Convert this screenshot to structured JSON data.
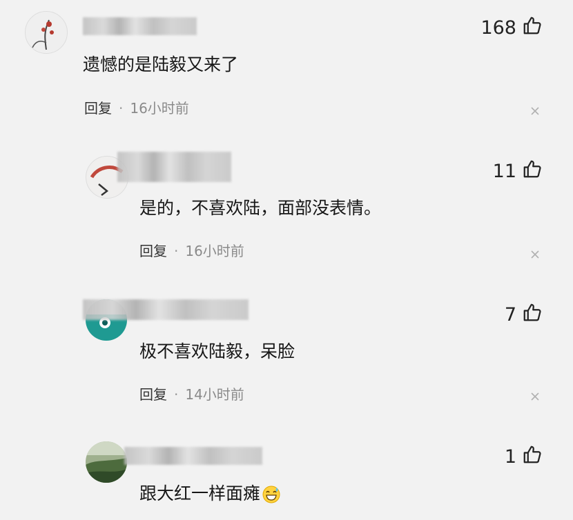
{
  "comments": [
    {
      "likes": "168",
      "text": "遗憾的是陆毅又来了",
      "reply_label": "回复",
      "time": "16小时前"
    },
    {
      "likes": "11",
      "text": "是的，不喜欢陆，面部没表情。",
      "reply_label": "回复",
      "time": "16小时前"
    },
    {
      "likes": "7",
      "text": "极不喜欢陆毅，呆脸",
      "reply_label": "回复",
      "time": "14小时前"
    },
    {
      "likes": "1",
      "text": "跟大红一样面瘫",
      "emoji": "grinning-sweat-emoji"
    }
  ],
  "separator": "·",
  "icons": {
    "like": "thumbs-up-icon",
    "close": "close-icon"
  }
}
